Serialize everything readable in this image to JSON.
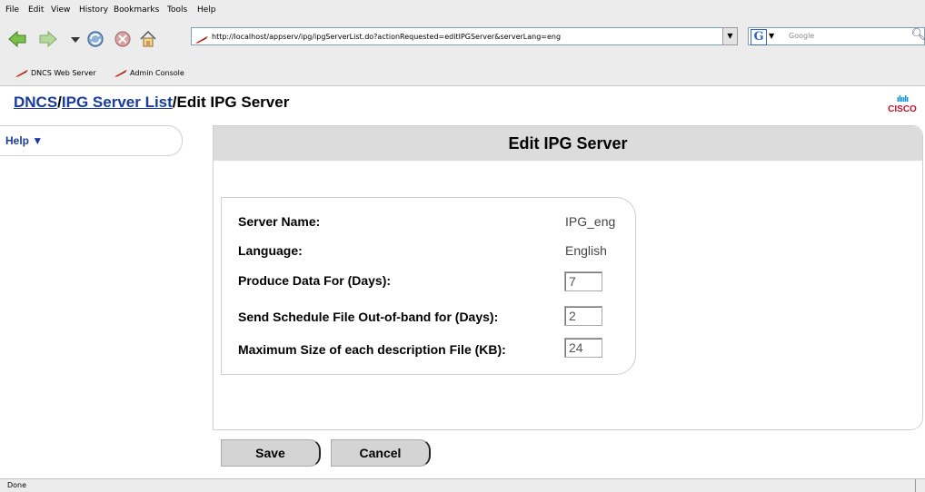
{
  "browser": {
    "menu": [
      "File",
      "Edit",
      "View",
      "History",
      "Bookmarks",
      "Tools",
      "Help"
    ],
    "url": "http://localhost/appserv/ipg/ipgServerList.do?actionRequested=editIPGServer&serverLang=eng",
    "search_placeholder": "Google",
    "bookmarks": [
      "DNCS Web Server",
      "Admin Console"
    ],
    "status": "Done"
  },
  "breadcrumb": {
    "dncs": "DNCS",
    "sep1": "/",
    "ipg_list": "IPG Server List",
    "sep2": "/",
    "current": "Edit IPG Server"
  },
  "brand": {
    "logo_text": "CISCO"
  },
  "sidebar": {
    "help_label": "Help ▼"
  },
  "panel": {
    "title": "Edit IPG Server"
  },
  "form": {
    "server_name_label": "Server Name:",
    "server_name_value": "IPG_eng",
    "language_label": "Language:",
    "language_value": "English",
    "produce_days_label": "Produce Data For (Days):",
    "produce_days_value": "7",
    "send_schedule_label": "Send Schedule File Out-of-band for (Days):",
    "send_schedule_value": "2",
    "max_size_label": "Maximum Size of each description File (KB):",
    "max_size_value": "24"
  },
  "actions": {
    "save_label": "Save",
    "cancel_label": "Cancel"
  }
}
